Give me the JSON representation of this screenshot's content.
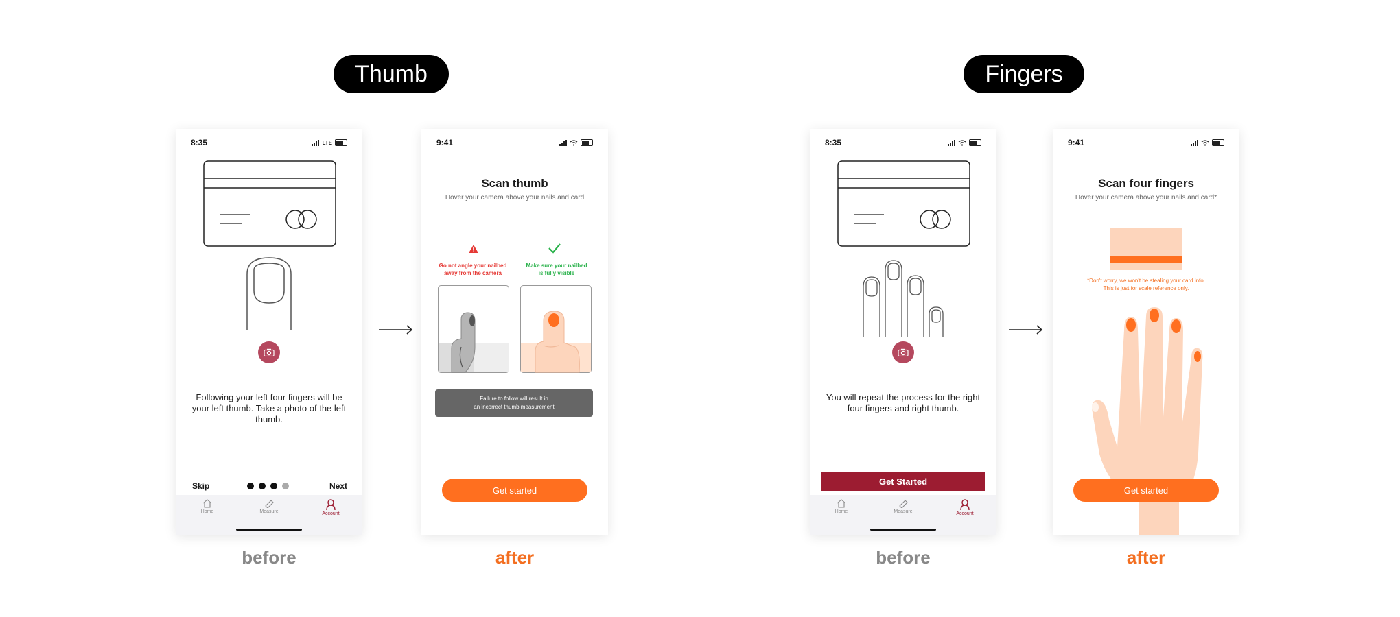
{
  "sections": [
    {
      "title": "Thumb"
    },
    {
      "title": "Fingers"
    }
  ],
  "labels": {
    "before": "before",
    "after": "after"
  },
  "screens": {
    "thumb_before": {
      "time": "8:35",
      "network": "LTE",
      "body": "Following your left four fingers will be your left thumb. Take a photo of the left thumb.",
      "skip": "Skip",
      "next": "Next",
      "step": 3,
      "steps": 4,
      "tabs": [
        "Home",
        "Measure",
        "Account"
      ]
    },
    "thumb_after": {
      "time": "9:41",
      "title": "Scan thumb",
      "subtitle": "Hover your camera above your nails and card",
      "bad_line1": "Go not angle your nailbed",
      "bad_line2": "away from the camera",
      "good_line1": "Make sure your nailbed",
      "good_line2": "is fully visible",
      "warning_line1": "Failure to follow will result in",
      "warning_line2": "an incorrect thumb measurement",
      "cta": "Get started"
    },
    "fingers_before": {
      "time": "8:35",
      "body": "You will repeat the process for the right four fingers and right thumb.",
      "cta": "Get Started",
      "tabs": [
        "Home",
        "Measure",
        "Account"
      ]
    },
    "fingers_after": {
      "time": "9:41",
      "title": "Scan four fingers",
      "subtitle": "Hover your camera above your nails and card*",
      "note_line1": "*Don't worry, we won't be stealing your card info.",
      "note_line2": "This is just for scale reference only.",
      "cta": "Get started"
    }
  },
  "colors": {
    "brand_red": "#9c1c31",
    "accent_orange": "#ff6f1f",
    "error": "#e53935",
    "success": "#2bb24c",
    "skin": "#fdd5bc"
  }
}
